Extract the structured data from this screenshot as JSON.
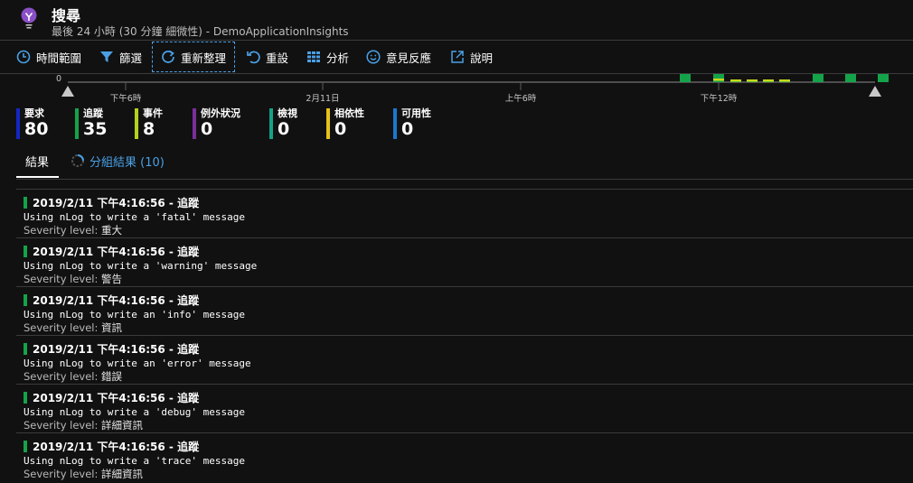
{
  "header": {
    "title": "搜尋",
    "subtitle": "最後 24 小時 (30 分鐘 細微性) - DemoApplicationInsights",
    "icon": "lightbulb-icon",
    "icon_color": "#8a4fc4"
  },
  "toolbar": {
    "time_range": "時間範圍",
    "filter": "篩選",
    "refresh": "重新整理",
    "reset": "重設",
    "analytics": "分析",
    "feedback": "意見反應",
    "help": "說明",
    "accent": "#4aa0e6"
  },
  "chart_data": {
    "type": "bar",
    "y_zero_label": "0",
    "x_tick_labels": [
      "下午6時",
      "2月11日",
      "上午6時",
      "下午12時"
    ],
    "series": [
      {
        "color": "#15a34a",
        "values": [
          1,
          1,
          0.2,
          0.2,
          0.2,
          0.2,
          1,
          0,
          1,
          0,
          1
        ]
      },
      {
        "color": "#c8d81b",
        "values": [
          0,
          1,
          1,
          1,
          1,
          1,
          0,
          0,
          0,
          0,
          0
        ]
      }
    ]
  },
  "metrics": [
    {
      "label": "要求",
      "value": "80",
      "color": "#1427c2"
    },
    {
      "label": "追蹤",
      "value": "35",
      "color": "#15a34a"
    },
    {
      "label": "事件",
      "value": "8",
      "color": "#b6d11a"
    },
    {
      "label": "例外狀況",
      "value": "0",
      "color": "#7a2e9c"
    },
    {
      "label": "檢視",
      "value": "0",
      "color": "#14a388"
    },
    {
      "label": "相依性",
      "value": "0",
      "color": "#e8c11a"
    },
    {
      "label": "可用性",
      "value": "0",
      "color": "#1a78cf"
    }
  ],
  "tabs": {
    "results": "結果",
    "grouped": "分組結果 (10)"
  },
  "results": [
    {
      "title": "2019/2/11 下午4:16:56 - 追蹤",
      "message": "Using nLog to write a 'fatal' message",
      "severity_label": "Severity level:",
      "severity": "重大"
    },
    {
      "title": "2019/2/11 下午4:16:56 - 追蹤",
      "message": "Using nLog to write a 'warning' message",
      "severity_label": "Severity level:",
      "severity": "警告"
    },
    {
      "title": "2019/2/11 下午4:16:56 - 追蹤",
      "message": "Using nLog to write an 'info' message",
      "severity_label": "Severity level:",
      "severity": "資訊"
    },
    {
      "title": "2019/2/11 下午4:16:56 - 追蹤",
      "message": "Using nLog to write an 'error' message",
      "severity_label": "Severity level:",
      "severity": "錯誤"
    },
    {
      "title": "2019/2/11 下午4:16:56 - 追蹤",
      "message": "Using nLog to write a 'debug' message",
      "severity_label": "Severity level:",
      "severity": "詳細資訊"
    },
    {
      "title": "2019/2/11 下午4:16:56 - 追蹤",
      "message": "Using nLog to write a 'trace' message",
      "severity_label": "Severity level:",
      "severity": "詳細資訊"
    }
  ]
}
